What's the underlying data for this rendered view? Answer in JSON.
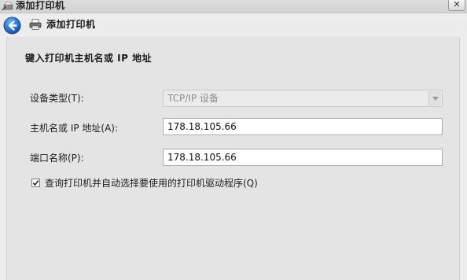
{
  "window": {
    "title": "添加打印机",
    "close_glyph": "✕"
  },
  "header": {
    "title": "添加打印机"
  },
  "main": {
    "heading": "键入打印机主机名或 IP 地址",
    "device_type": {
      "label": "设备类型(T):",
      "value": "TCP/IP 设备",
      "enabled": false
    },
    "host": {
      "label": "主机名或 IP 地址(A):",
      "value": "178.18.105.66"
    },
    "port": {
      "label": "端口名称(P):",
      "value": "178.18.105.66"
    },
    "query_checkbox": {
      "label": "查询打印机并自动选择要使用的打印机驱动程序(Q)",
      "checked": true
    }
  },
  "icons": {
    "title": "printer-wand-icon",
    "back": "back-arrow-icon",
    "printer": "printer-icon",
    "close": "close-icon",
    "dropdown": "chevron-down-icon",
    "check": "checkmark-icon"
  },
  "colors": {
    "back_button": "#2a79d3",
    "window_bg": "#ededed",
    "panel_bg": "#e4e4e4"
  }
}
